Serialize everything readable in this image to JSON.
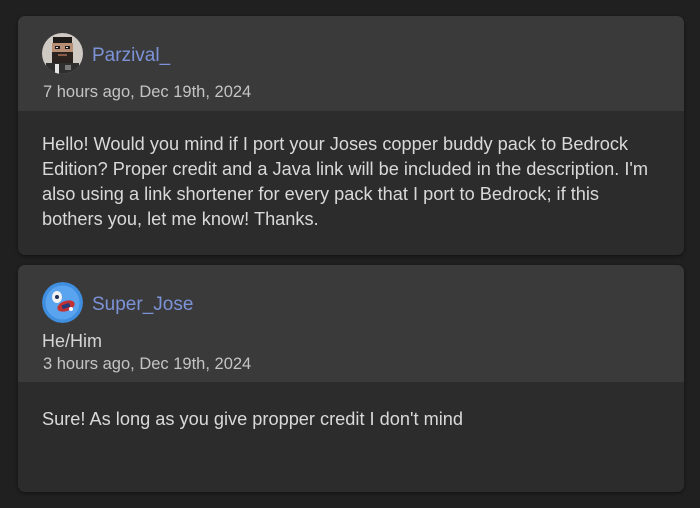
{
  "comments": [
    {
      "username": "Parzival_",
      "timestamp": "7 hours ago, Dec 19th, 2024",
      "text": "Hello! Would you mind if I port your Joses copper buddy pack to Bedrock Edition? Proper credit and a Java link will be included in the description. I'm also using a link shortener for every pack that I port to Bedrock; if this bothers you, let me know! Thanks.",
      "avatar_icon": "pixel-bearded-man-avatar"
    },
    {
      "username": "Super_Jose",
      "pronouns": "He/Him",
      "timestamp": "3 hours ago, Dec 19th, 2024",
      "text": "Sure! As long as you give propper credit I don't mind",
      "avatar_icon": "blue-cartoon-avatar"
    }
  ],
  "colors": {
    "page_bg": "#202020",
    "card_header_bg": "#3a3a3a",
    "card_body_bg": "#2c2c2c",
    "username": "#7d93d8"
  }
}
